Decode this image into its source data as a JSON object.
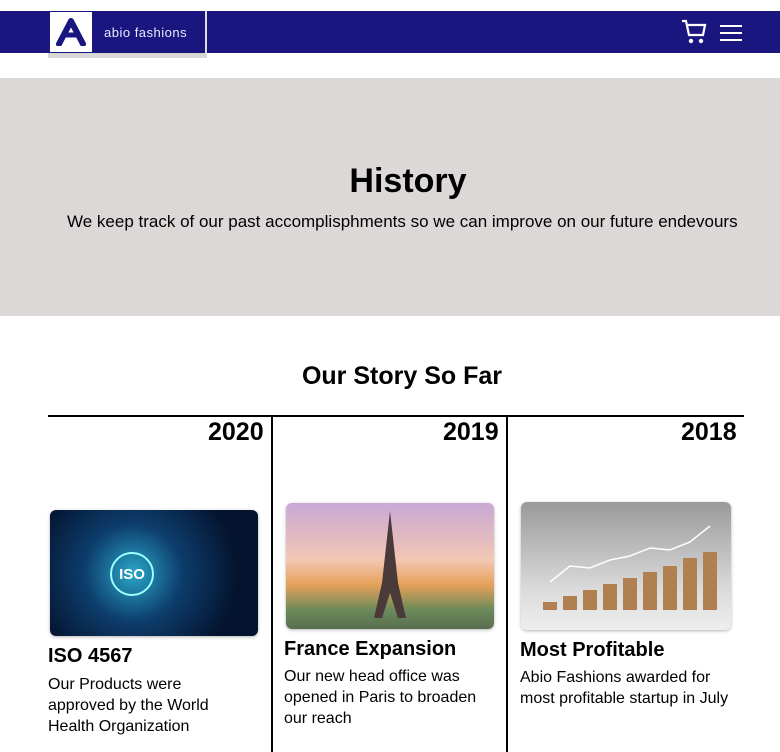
{
  "brand": {
    "logo_letter": "A",
    "name": "abio fashions"
  },
  "nav": {
    "cart_icon": "cart-icon",
    "menu_icon": "hamburger-icon"
  },
  "hero": {
    "title": "History",
    "subtitle": "We keep track of our past accomplisphments so we can improve on our future endevours"
  },
  "section_title": "Our Story So Far",
  "timeline": [
    {
      "year": "2020",
      "title": "ISO 4567",
      "description": "Our Products were approved by the World Health Organization",
      "image_label": "ISO"
    },
    {
      "year": "2019",
      "title": "France Expansion",
      "description": "Our new head office was opened in Paris to broaden our reach"
    },
    {
      "year": "2018",
      "title": "Most Profitable",
      "description": "Abio Fashions awarded for most profitable startup in July"
    }
  ]
}
